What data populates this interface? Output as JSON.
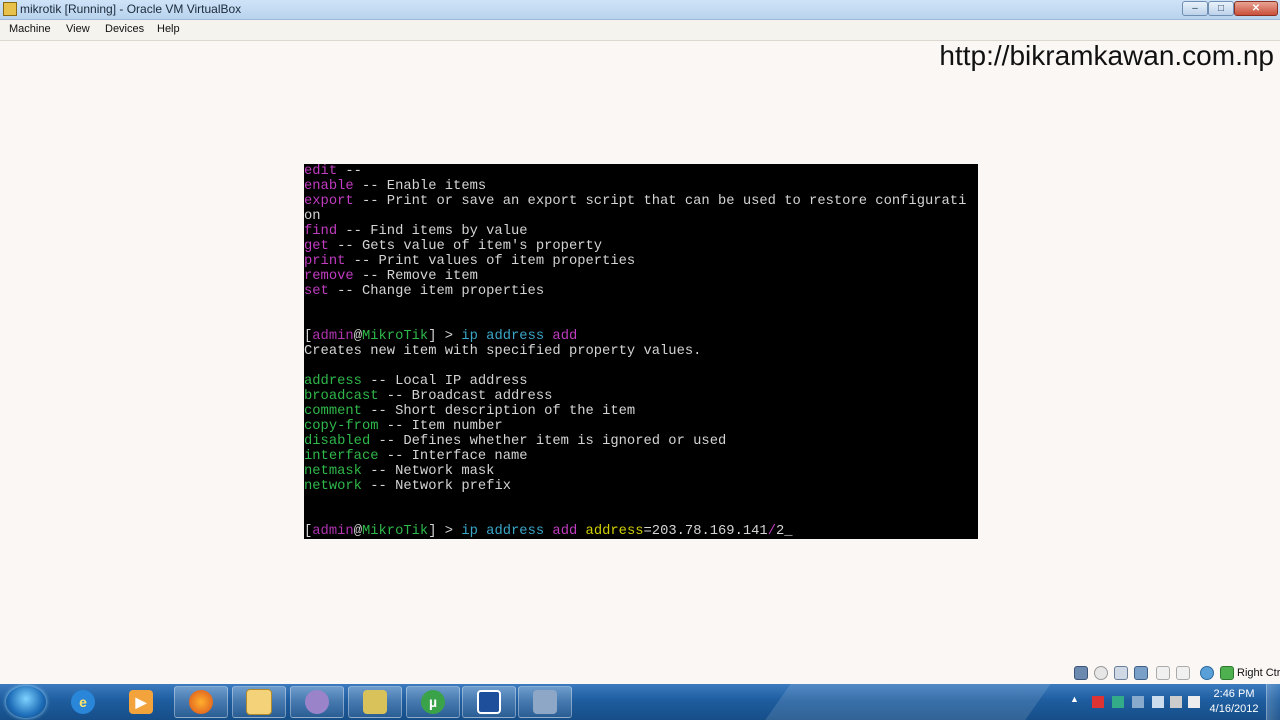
{
  "window": {
    "title": "mikrotik [Running] - Oracle VM VirtualBox",
    "buttons": {
      "minimize": "–",
      "maximize": "□",
      "close": "✕"
    }
  },
  "menu": [
    "Machine",
    "View",
    "Devices",
    "Help"
  ],
  "watermark": "http://bikramkawan.com.np",
  "console": {
    "commands_list": [
      {
        "name": "edit",
        "desc": " --"
      },
      {
        "name": "enable",
        "desc": " -- Enable items"
      },
      {
        "name": "export",
        "desc": " -- Print or save an export script that can be used to restore configurati"
      },
      {
        "name": "",
        "desc": "on"
      },
      {
        "name": "find",
        "desc": " -- Find items by value"
      },
      {
        "name": "get",
        "desc": " -- Gets value of item's property"
      },
      {
        "name": "print",
        "desc": " -- Print values of item properties"
      },
      {
        "name": "remove",
        "desc": " -- Remove item"
      },
      {
        "name": "set",
        "desc": " -- Change item properties"
      }
    ],
    "prompt1": {
      "open": "[",
      "user": "admin",
      "at": "@",
      "host": "MikroTik",
      "close": "] > ",
      "cmd1": "ip address",
      "cmd2": " add"
    },
    "help_line": "Creates new item with specified property values.",
    "properties": [
      {
        "name": "address",
        "desc": " -- Local IP address"
      },
      {
        "name": "broadcast",
        "desc": " -- Broadcast address"
      },
      {
        "name": "comment",
        "desc": " -- Short description of the item"
      },
      {
        "name": "copy-from",
        "desc": " -- Item number"
      },
      {
        "name": "disabled",
        "desc": " -- Defines whether item is ignored or used"
      },
      {
        "name": "interface",
        "desc": " -- Interface name"
      },
      {
        "name": "netmask",
        "desc": " -- Network mask"
      },
      {
        "name": "network",
        "desc": " -- Network prefix"
      }
    ],
    "prompt2": {
      "open": "[",
      "user": "admin",
      "at": "@",
      "host": "MikroTik",
      "close": "] > ",
      "cmd1": "ip address",
      "cmd2": " add",
      "arg": " address",
      "eq": "=",
      "value": "203.78.169.141",
      "slash": "/",
      "partial": "2",
      "cursor": "_"
    }
  },
  "statusbar": {
    "host_key": "Right Ctrl"
  },
  "taskbar": {
    "items": [
      "Start",
      "Internet Explorer",
      "Windows Media Player",
      "Firefox",
      "Windows Explorer",
      "Pidgin",
      "Network tool",
      "uTorrent",
      "Remote desktop",
      "Oracle VM VirtualBox"
    ],
    "clock_time": "2:46 PM",
    "clock_date": "4/16/2012"
  },
  "colors": {
    "keyword": "#c03cc0",
    "green": "#2fb84a",
    "blue": "#3aa6c8",
    "console_bg": "#000000",
    "taskbar": "#1e5d9f"
  }
}
